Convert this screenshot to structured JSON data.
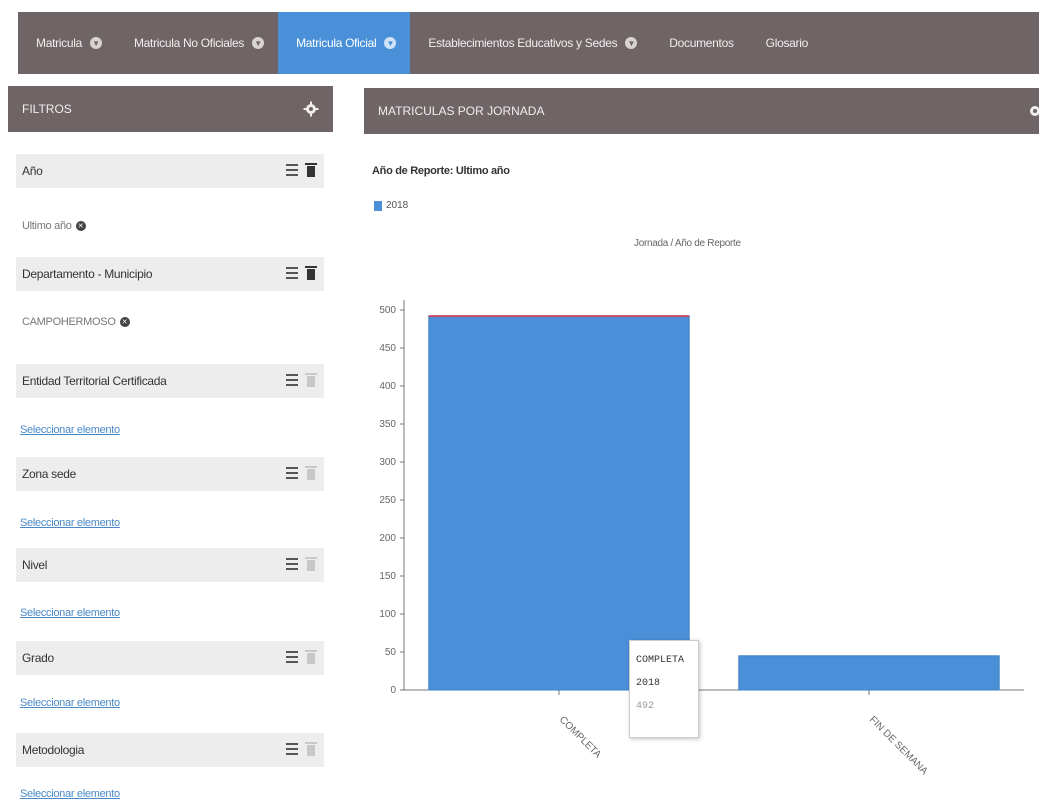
{
  "nav": {
    "tabs": [
      {
        "label": "Matricula",
        "active": false,
        "has_caret": true
      },
      {
        "label": "Matricula No Oficiales",
        "active": false,
        "has_caret": true
      },
      {
        "label": "Matricula Oficial",
        "active": true,
        "has_caret": true
      },
      {
        "label": "Establecimientos Educativos y Sedes",
        "active": false,
        "has_caret": true
      },
      {
        "label": "Documentos",
        "active": false,
        "has_caret": false
      },
      {
        "label": "Glosario",
        "active": false,
        "has_caret": false
      }
    ]
  },
  "filters": {
    "title": "FILTROS",
    "gear_icon": "gear-icon",
    "items": [
      {
        "label": "Año",
        "value": "Ultimo año",
        "link": null,
        "trash_active": true
      },
      {
        "label": "Departamento - Municipio",
        "value": "CAMPOHERMOSO",
        "link": null,
        "trash_active": true
      },
      {
        "label": "Entidad Territorial Certificada",
        "value": null,
        "link": "Seleccionar elemento",
        "trash_active": false
      },
      {
        "label": "Zona sede",
        "value": null,
        "link": "Seleccionar elemento",
        "trash_active": false
      },
      {
        "label": "Nivel",
        "value": null,
        "link": "Seleccionar elemento",
        "trash_active": false
      },
      {
        "label": "Grado",
        "value": null,
        "link": "Seleccionar elemento",
        "trash_active": false
      },
      {
        "label": "Metodologia",
        "value": null,
        "link": "Seleccionar elemento",
        "trash_active": false
      }
    ]
  },
  "chart_panel": {
    "title": "MATRICULAS POR JORNADA",
    "report_line": "Año de Reporte: Ultimo año",
    "subtitle": "Jornada / Año de Reporte"
  },
  "chart_data": {
    "type": "bar",
    "categories": [
      "COMPLETA",
      "FIN DE SEMANA"
    ],
    "series": [
      {
        "name": "2018",
        "values": [
          492,
          45
        ],
        "color": "#4a90d9"
      }
    ],
    "ylim": [
      0,
      500
    ],
    "yticks": [
      0,
      50,
      100,
      150,
      200,
      250,
      300,
      350,
      400,
      450,
      500
    ],
    "legend": "top-left"
  },
  "tooltip": {
    "category": "COMPLETA",
    "series": "2018",
    "value": "492"
  }
}
